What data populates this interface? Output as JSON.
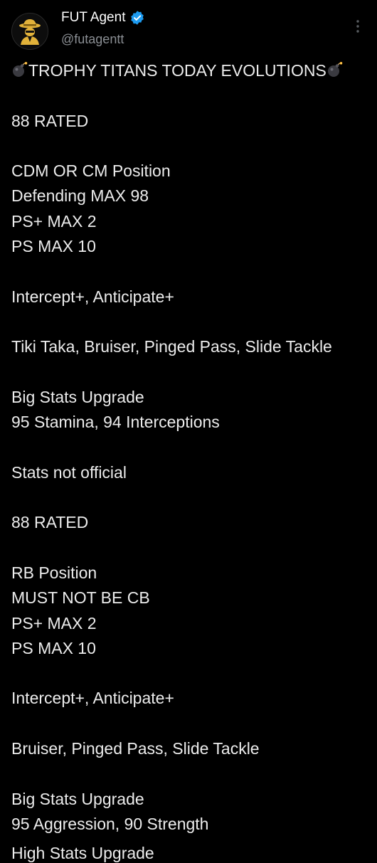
{
  "header": {
    "display_name": "FUT Agent",
    "handle": "@futagentt",
    "verified_icon": "verified-badge-icon",
    "more_icon": "more-vertical-icon",
    "accent_color": "#1d9bf0"
  },
  "tweet": {
    "title_text": "TROPHY TITANS TODAY EVOLUTIONS",
    "title_icon": "bomb-emoji-icon",
    "lines": [
      "88 RATED",
      "",
      "CDM OR CM Position",
      "Defending MAX 98",
      "PS+ MAX 2",
      "PS MAX 10",
      "",
      "Intercept+, Anticipate+",
      "",
      "Tiki Taka, Bruiser, Pinged Pass, Slide Tackle",
      "",
      "Big Stats Upgrade",
      "95 Stamina, 94 Interceptions",
      "",
      "Stats not official",
      "",
      "88 RATED",
      "",
      "RB Position",
      "MUST NOT BE CB",
      "PS+ MAX 2",
      "PS MAX 10",
      "",
      "Intercept+, Anticipate+",
      "",
      "Bruiser, Pinged Pass, Slide Tackle",
      "",
      "Big Stats Upgrade",
      "95 Aggression, 90 Strength"
    ],
    "cut_line": "High Stats Upgrade"
  }
}
